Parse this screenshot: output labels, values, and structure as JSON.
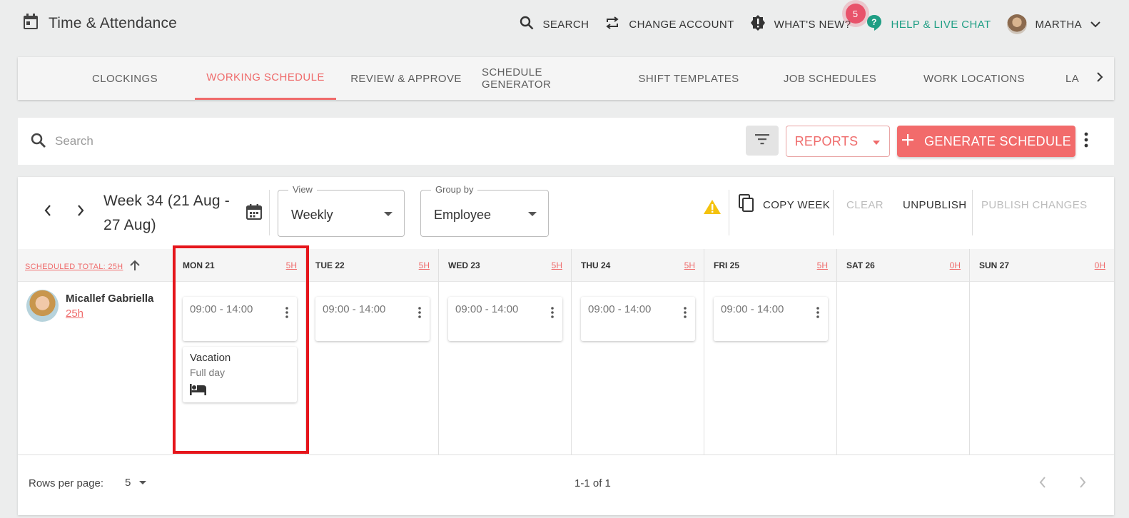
{
  "app": {
    "title": "Time & Attendance"
  },
  "topnav": {
    "search": "SEARCH",
    "change_account": "CHANGE ACCOUNT",
    "whats_new": "WHAT'S NEW?",
    "whats_new_badge": "5",
    "help": "HELP & LIVE CHAT",
    "user": "MARTHA"
  },
  "tabs": [
    {
      "label": "CLOCKINGS"
    },
    {
      "label": "WORKING SCHEDULE"
    },
    {
      "label": "REVIEW & APPROVE"
    },
    {
      "label": "SCHEDULE GENERATOR"
    },
    {
      "label": "SHIFT TEMPLATES"
    },
    {
      "label": "JOB SCHEDULES"
    },
    {
      "label": "WORK LOCATIONS"
    },
    {
      "label": "LA"
    }
  ],
  "active_tab": "WORKING SCHEDULE",
  "search": {
    "placeholder": "Search"
  },
  "toolbar": {
    "reports": "REPORTS",
    "generate": "GENERATE SCHEDULE"
  },
  "schedule": {
    "week_label": "Week 34 (21 Aug - 27 Aug)",
    "view": {
      "label": "View",
      "value": "Weekly"
    },
    "group_by": {
      "label": "Group by",
      "value": "Employee"
    },
    "actions": {
      "copy_week": "COPY WEEK",
      "clear": "CLEAR",
      "unpublish": "UNPUBLISH",
      "publish": "PUBLISH CHANGES"
    },
    "scheduled_total": "SCHEDULED TOTAL: 25H",
    "days": [
      {
        "label": "MON 21",
        "hours": "5H"
      },
      {
        "label": "TUE 22",
        "hours": "5H"
      },
      {
        "label": "WED 23",
        "hours": "5H"
      },
      {
        "label": "THU 24",
        "hours": "5H"
      },
      {
        "label": "FRI 25",
        "hours": "5H"
      },
      {
        "label": "SAT 26",
        "hours": "0H"
      },
      {
        "label": "SUN 27",
        "hours": "0H"
      }
    ],
    "employee": {
      "name": "Micallef Gabriella",
      "hours": "25h"
    },
    "shifts": [
      "09:00 - 14:00",
      "09:00 - 14:00",
      "09:00 - 14:00",
      "09:00 - 14:00",
      "09:00 - 14:00"
    ],
    "vacation": {
      "title": "Vacation",
      "subtitle": "Full day"
    }
  },
  "footer": {
    "rows_label": "Rows per page:",
    "rows_value": "5",
    "range": "1-1 of 1"
  },
  "colors": {
    "accent": "#ef6b6b",
    "help": "#1f9e84",
    "highlight": "#e5151b"
  }
}
